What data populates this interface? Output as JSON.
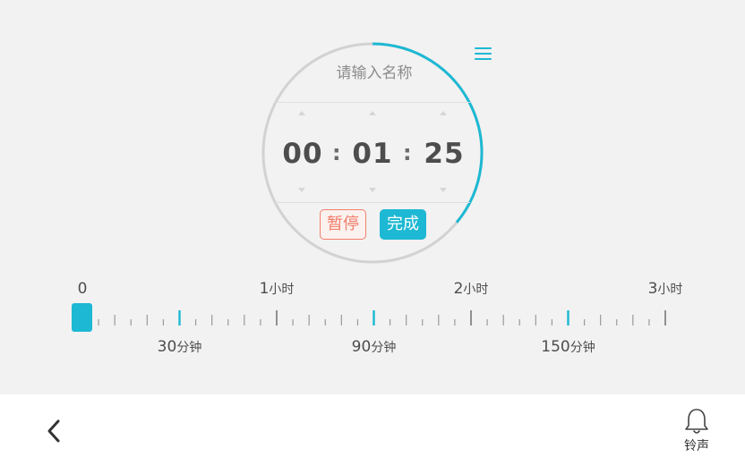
{
  "colors": {
    "accent": "#1db8d3",
    "pause": "#f27d6b",
    "ring": "#d2d2d2"
  },
  "timer": {
    "name_placeholder": "请输入名称",
    "hours": "00",
    "minutes": "01",
    "seconds": "25",
    "separator": ":",
    "progress_fraction": 0.36,
    "menu_icon": "hamburger-menu-icon"
  },
  "buttons": {
    "pause": "暂停",
    "done": "完成"
  },
  "ruler": {
    "min_minutes": 0,
    "max_minutes": 180,
    "tick_every_minutes": 5,
    "value_minutes": 0,
    "top_labels": [
      {
        "minutes": 0,
        "num": "0",
        "unit": ""
      },
      {
        "minutes": 60,
        "num": "1",
        "unit": "小时"
      },
      {
        "minutes": 120,
        "num": "2",
        "unit": "小时"
      },
      {
        "minutes": 180,
        "num": "3",
        "unit": "小时"
      }
    ],
    "bottom_labels": [
      {
        "minutes": 30,
        "num": "30",
        "unit": "分钟"
      },
      {
        "minutes": 90,
        "num": "90",
        "unit": "分钟"
      },
      {
        "minutes": 150,
        "num": "150",
        "unit": "分钟"
      }
    ]
  },
  "bottom_bar": {
    "back_icon": "chevron-left-icon",
    "bell_icon": "bell-icon",
    "bell_label": "铃声"
  }
}
